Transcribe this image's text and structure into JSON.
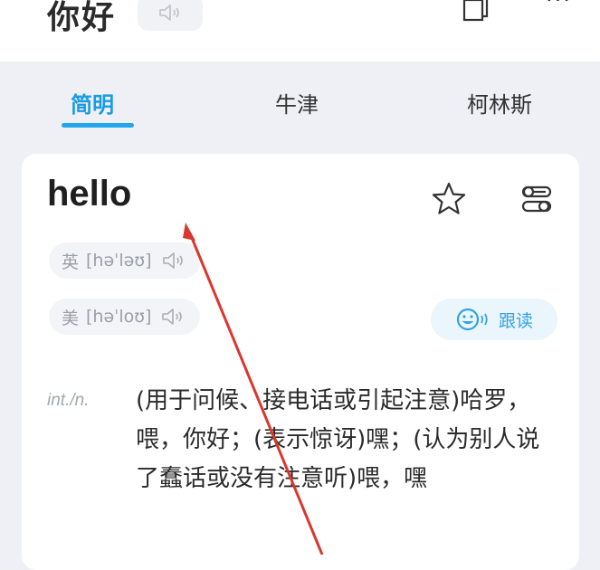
{
  "header": {
    "query": "你好",
    "speaker_icon": "speaker-icon",
    "copy_icon": "copy-icon",
    "more_label": "···"
  },
  "tabs": [
    {
      "label": "简明",
      "active": true
    },
    {
      "label": "牛津",
      "active": false
    },
    {
      "label": "柯林斯",
      "active": false
    }
  ],
  "card": {
    "word": "hello",
    "favorite_icon": "star-icon",
    "settings_icon": "settings-icon",
    "pronunciations": [
      {
        "region": "英",
        "phonetic": "[həˈləʊ]"
      },
      {
        "region": "美",
        "phonetic": "[həˈloʊ]"
      }
    ],
    "follow_read": {
      "label": "跟读",
      "icon": "smile-mic-icon"
    },
    "definitions": [
      {
        "pos": "int./n.",
        "text": "(用于问候、接电话或引起注意)哈罗，喂，你好；(表示惊讶)嘿；(认为别人说了蠢话或没有注意听)喂，嘿"
      }
    ]
  },
  "colors": {
    "accent": "#1a9be6",
    "background": "#eef0f5",
    "card": "#ffffff",
    "annotation_arrow": "#d9382e"
  }
}
